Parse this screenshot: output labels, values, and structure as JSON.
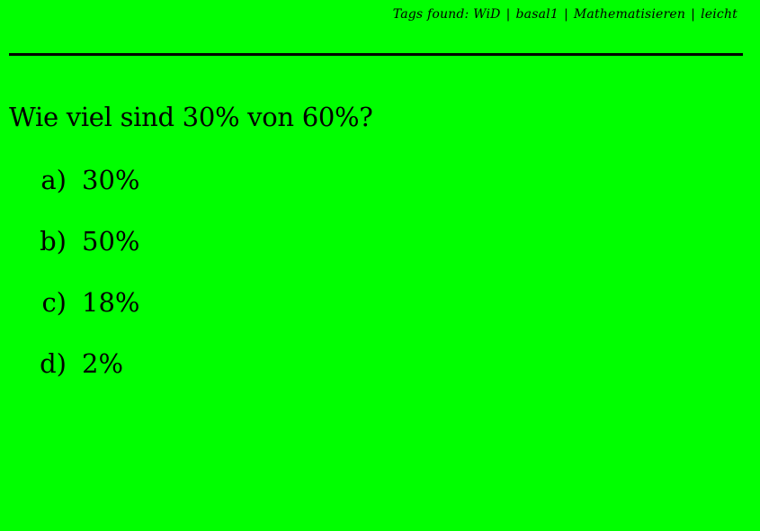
{
  "header": {
    "tags_label": "Tags found:",
    "tags": [
      "WiD",
      "basal1",
      "Mathematisieren",
      "leicht"
    ],
    "separator": "|"
  },
  "question": "Wie viel sind 30% von 60%?",
  "options": [
    {
      "marker": "a)",
      "text": "30%"
    },
    {
      "marker": "b)",
      "text": "50%"
    },
    {
      "marker": "c)",
      "text": "18%"
    },
    {
      "marker": "d)",
      "text": "2%"
    }
  ],
  "colors": {
    "background": "#00ff00",
    "text": "#000000"
  }
}
